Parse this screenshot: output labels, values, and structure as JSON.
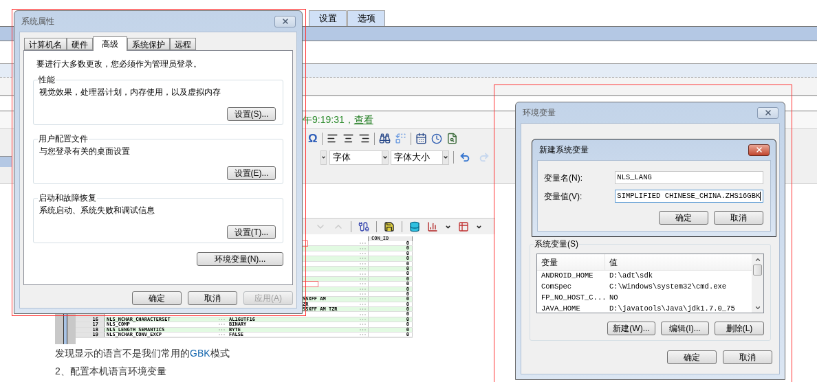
{
  "page": {
    "tabs": [
      "设置",
      "选项"
    ],
    "editor": {
      "status": "午9:19:31，",
      "status_link": "查看",
      "symbol": "Ω",
      "font_select": "字体",
      "size_select": "字体大小"
    },
    "grid": {
      "header": "CON_ID",
      "rows": [
        {
          "con_id": "0",
          "highlighted": true
        },
        {
          "con_id": "0",
          "highlighted": false
        },
        {
          "con_id": "0",
          "highlighted": false
        },
        {
          "con_id": "0",
          "highlighted": false
        },
        {
          "con_id": "0",
          "highlighted": false
        },
        {
          "con_id": "0",
          "highlighted": false
        },
        {
          "con_id": "0",
          "highlighted": false
        },
        {
          "con_id": "0",
          "highlighted": false
        },
        {
          "con_id": "0",
          "highlighted": true
        },
        {
          "con_id": "0",
          "highlighted": false
        },
        {
          "con_id": "0",
          "highlighted": false
        },
        {
          "value": "SSXFF AM",
          "con_id": "0",
          "highlighted": false
        },
        {
          "value": "ZR",
          "con_id": "0",
          "highlighted": false
        },
        {
          "value": "SSXFF AM TZR",
          "con_id": "0",
          "highlighted": false
        },
        {
          "con_id": "0",
          "highlighted": false
        },
        {
          "number": "16",
          "name": "NLS_NCHAR_CHARACTERSET",
          "value": "AL16UTF16",
          "con_id": "0",
          "highlighted": false
        },
        {
          "number": "17",
          "name": "NLS_COMP",
          "value": "BINARY",
          "con_id": "0",
          "highlighted": false
        },
        {
          "number": "18",
          "name": "NLS_LENGTH_SEMANTICS",
          "value": "BYTE",
          "con_id": "0",
          "highlighted": false
        },
        {
          "number": "19",
          "name": "NLS_NCHAR_CONV_EXCP",
          "value": "FALSE",
          "con_id": "0",
          "highlighted": false
        }
      ]
    },
    "paragraph": {
      "text": "发现显示的语言不是我们常用的",
      "highlight": "GBK",
      "after": "模式"
    },
    "heading": "2、配置本机语言环境变量"
  },
  "system_properties": {
    "title": "系统属性",
    "active": false,
    "tabs": [
      {
        "label": "计算机名",
        "selected": false
      },
      {
        "label": "硬件",
        "selected": false
      },
      {
        "label": "高级",
        "selected": true
      },
      {
        "label": "系统保护",
        "selected": false
      },
      {
        "label": "远程",
        "selected": false
      }
    ],
    "note": "要进行大多数更改，您必须作为管理员登录。",
    "groups": [
      {
        "title": "性能",
        "description": "视觉效果，处理器计划，内存使用，以及虚拟内存",
        "button": "设置(S)..."
      },
      {
        "title": "用户配置文件",
        "description": "与您登录有关的桌面设置",
        "button": "设置(E)..."
      },
      {
        "title": "启动和故障恢复",
        "description": "系统启动、系统失败和调试信息",
        "button": "设置(T)..."
      }
    ],
    "env_button": "环境变量(N)...",
    "buttons": [
      {
        "label": "确定",
        "disabled": false
      },
      {
        "label": "取消",
        "disabled": false
      },
      {
        "label": "应用(A)",
        "disabled": true
      }
    ]
  },
  "environment_variables": {
    "title": "环境变量",
    "active": false,
    "system_vars": {
      "title": "系统变量(S)",
      "columns": [
        "变量",
        "值"
      ],
      "rows": [
        {
          "name": "ANDROID_HOME",
          "value": "D:\\adt\\sdk"
        },
        {
          "name": "ComSpec",
          "value": "C:\\Windows\\system32\\cmd.exe"
        },
        {
          "name": "FP_NO_HOST_C...",
          "value": "NO"
        },
        {
          "name": "JAVA_HOME",
          "value": "D:\\javatools\\Java\\jdk1.7.0_75"
        }
      ],
      "buttons": [
        "新建(W)...",
        "编辑(I)...",
        "删除(L)"
      ]
    },
    "buttons": [
      "确定",
      "取消"
    ]
  },
  "new_variable": {
    "title": "新建系统变量",
    "active": true,
    "fields": [
      {
        "label": "变量名(N):",
        "value": "NLS_LANG",
        "focused": false
      },
      {
        "label": "变量值(V):",
        "value": "SIMPLIFIED CHINESE_CHINA.ZHS16GBK",
        "focused": true
      }
    ],
    "buttons": [
      "确定",
      "取消"
    ]
  }
}
